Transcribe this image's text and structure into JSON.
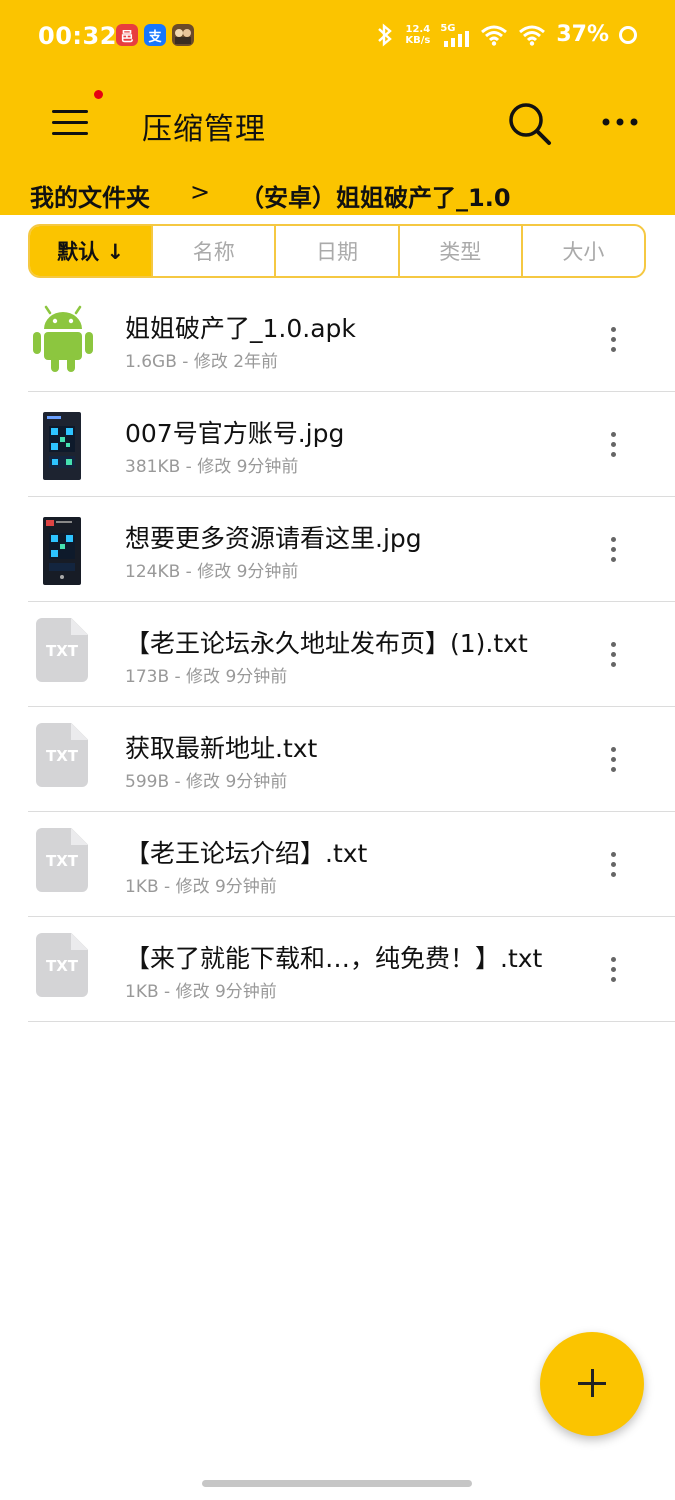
{
  "status_bar": {
    "time": "00:32",
    "app_badges": [
      {
        "icon": "pinduoduo-icon",
        "text": "邑",
        "color": "#e83e3e"
      },
      {
        "icon": "alipay-icon",
        "text": "支",
        "color": "#1677ff"
      },
      {
        "icon": "game-app-icon",
        "text": "",
        "color": "#6b4b2a"
      }
    ],
    "net_speed": "12.4",
    "net_speed_unit": "KB/s",
    "network": "5G",
    "battery": "37%"
  },
  "toolbar": {
    "title": "压缩管理",
    "menu_icon": "menu-icon",
    "search_icon": "search-icon",
    "more_icon": "more-horizontal-icon"
  },
  "breadcrumb": {
    "root": "我的文件夹",
    "separator": ">",
    "current": "（安卓）姐姐破产了_1.0"
  },
  "sort_tabs": [
    {
      "label": "默认 ↓",
      "active": true
    },
    {
      "label": "名称",
      "active": false
    },
    {
      "label": "日期",
      "active": false
    },
    {
      "label": "类型",
      "active": false
    },
    {
      "label": "大小",
      "active": false
    }
  ],
  "files": [
    {
      "name": "姐姐破产了_1.0.apk",
      "meta": "1.6GB - 修改 2年前",
      "type": "apk",
      "icon": "android-icon"
    },
    {
      "name": "007号官方账号.jpg",
      "meta": "381KB - 修改 9分钟前",
      "type": "jpg",
      "icon": "image-thumbnail"
    },
    {
      "name": "想要更多资源请看这里.jpg",
      "meta": "124KB - 修改 9分钟前",
      "type": "jpg",
      "icon": "image-thumbnail"
    },
    {
      "name": "【老王论坛永久地址发布页】(1).txt",
      "meta": "173B - 修改 9分钟前",
      "type": "txt",
      "icon": "txt-file-icon",
      "icon_label": "TXT"
    },
    {
      "name": "获取最新地址.txt",
      "meta": "599B - 修改 9分钟前",
      "type": "txt",
      "icon": "txt-file-icon",
      "icon_label": "TXT"
    },
    {
      "name": "【老王论坛介绍】.txt",
      "meta": "1KB - 修改 9分钟前",
      "type": "txt",
      "icon": "txt-file-icon",
      "icon_label": "TXT"
    },
    {
      "name": "【来了就能下载和…，纯免费！】.txt",
      "meta": "1KB - 修改 9分钟前",
      "type": "txt",
      "icon": "txt-file-icon",
      "icon_label": "TXT"
    }
  ],
  "fab": {
    "icon": "plus-icon"
  },
  "colors": {
    "accent": "#fbc400",
    "android_green": "#8cc63f",
    "notification_dot": "#e60012"
  }
}
